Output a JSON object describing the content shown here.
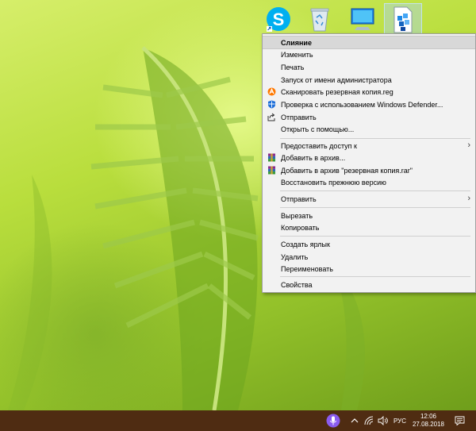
{
  "desktop": {
    "icons": [
      {
        "name": "skype-icon"
      },
      {
        "name": "recycle-bin-icon"
      },
      {
        "name": "this-pc-icon"
      },
      {
        "name": "registry-file-icon",
        "selected": true
      }
    ]
  },
  "context_menu": {
    "items": [
      {
        "label": "Слияние",
        "bold": true,
        "highlighted": true
      },
      {
        "label": "Изменить"
      },
      {
        "label": "Печать"
      },
      {
        "label": "Запуск от имени администратора"
      },
      {
        "label": "Сканировать резервная копия.reg",
        "icon": "avast-icon"
      },
      {
        "label": "Проверка с использованием Windows Defender...",
        "icon": "windows-defender-icon"
      },
      {
        "label": "Отправить",
        "icon": "share-icon"
      },
      {
        "label": "Открыть с помощью..."
      },
      {
        "label": "Предоставить доступ к",
        "submenu": true
      },
      {
        "label": "Добавить в архив...",
        "icon": "winrar-icon"
      },
      {
        "label": "Добавить в архив \"резервная копия.rar\"",
        "icon": "winrar-icon"
      },
      {
        "label": "Восстановить прежнюю версию"
      },
      {
        "label": "Отправить",
        "submenu": true
      },
      {
        "label": "Вырезать"
      },
      {
        "label": "Копировать"
      },
      {
        "label": "Создать ярлык"
      },
      {
        "label": "Удалить"
      },
      {
        "label": "Переименовать"
      },
      {
        "label": "Свойства"
      }
    ]
  },
  "taskbar": {
    "language": "РУС",
    "time": "12:06",
    "date": "27.08.2018",
    "colors": {
      "background": "#4f2c12",
      "cortana": "#8a5cf0"
    }
  }
}
